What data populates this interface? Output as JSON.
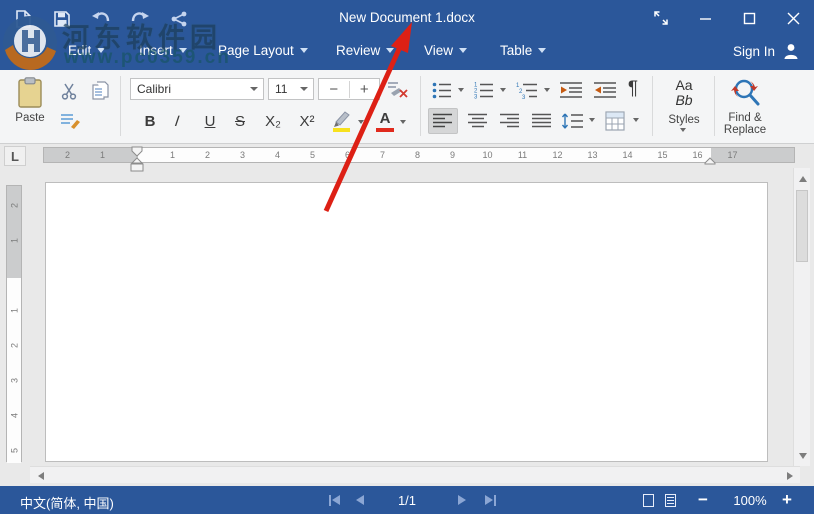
{
  "colors": {
    "accent": "#2b579a",
    "arrow_red": "#dd2015",
    "highlight_yellow": "#f7e11e",
    "font_color_red": "#e02a1d"
  },
  "watermark": {
    "title": "河东软件园",
    "url": "www.pc0359.cn"
  },
  "titlebar": {
    "title": "New Document 1.docx",
    "quick_actions": [
      "new-document",
      "save",
      "undo",
      "redo",
      "share"
    ],
    "window_controls": [
      "fullscreen",
      "minimize",
      "maximize",
      "close"
    ]
  },
  "menu": {
    "items": [
      {
        "label": "Edit"
      },
      {
        "label": "Insert"
      },
      {
        "label": "Page Layout"
      },
      {
        "label": "Review"
      },
      {
        "label": "View"
      },
      {
        "label": "Table"
      }
    ],
    "sign_in": "Sign In"
  },
  "ribbon": {
    "paste_label": "Paste",
    "font_name": "Calibri",
    "font_size": "11",
    "decrease_size": "−",
    "increase_size": "+",
    "bold": "B",
    "italic": "I",
    "underline": "U",
    "strikethrough": "S",
    "subscript": "X₂",
    "superscript": "X²",
    "font_color_letter": "A",
    "pilcrow": "¶",
    "styles": {
      "preview_line1": "Aa",
      "preview_line2": "Bb",
      "label": "Styles"
    },
    "find_replace": {
      "line1": "Find &",
      "line2": "Replace"
    }
  },
  "ruler": {
    "tab_selector": "L",
    "h_margin_numbers": [
      "2",
      "1"
    ],
    "h_active_numbers": [
      "1",
      "2",
      "3",
      "4",
      "5",
      "6",
      "7",
      "8",
      "9",
      "10",
      "11",
      "12",
      "13",
      "14",
      "15",
      "16"
    ],
    "h_right_numbers": [
      "17"
    ],
    "v_margin_numbers": [
      "2",
      "1"
    ],
    "v_active_numbers": [
      "1",
      "2",
      "3",
      "4",
      "5"
    ]
  },
  "statusbar": {
    "language": "中文(简体, 中国)",
    "page_indicator": "1/1",
    "zoom_out": "−",
    "zoom_level": "100%",
    "zoom_in": "+"
  }
}
